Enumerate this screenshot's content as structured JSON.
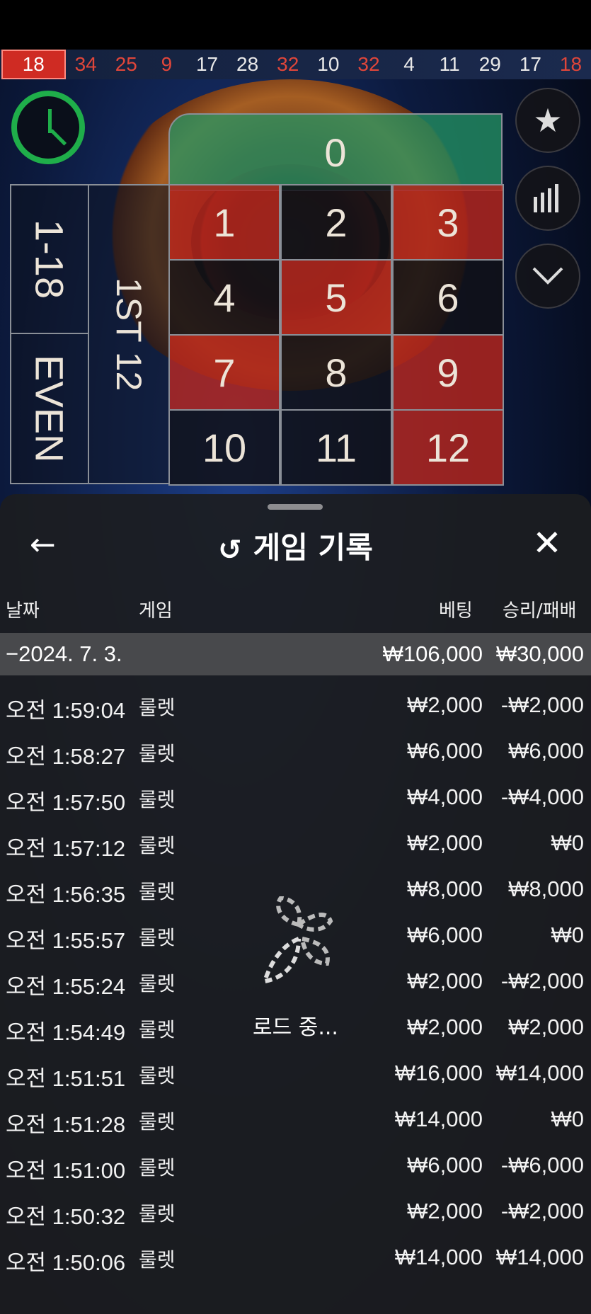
{
  "recent_results": [
    {
      "n": "18",
      "color": "red"
    },
    {
      "n": "34",
      "color": "red"
    },
    {
      "n": "25",
      "color": "red"
    },
    {
      "n": "9",
      "color": "red"
    },
    {
      "n": "17",
      "color": "black"
    },
    {
      "n": "28",
      "color": "black"
    },
    {
      "n": "32",
      "color": "red"
    },
    {
      "n": "10",
      "color": "black"
    },
    {
      "n": "32",
      "color": "red"
    },
    {
      "n": "4",
      "color": "black"
    },
    {
      "n": "11",
      "color": "black"
    },
    {
      "n": "29",
      "color": "black"
    },
    {
      "n": "17",
      "color": "black"
    },
    {
      "n": "18",
      "color": "red"
    }
  ],
  "board": {
    "zero": "0",
    "numbers": [
      {
        "n": "1",
        "c": "red"
      },
      {
        "n": "2",
        "c": "black"
      },
      {
        "n": "3",
        "c": "red"
      },
      {
        "n": "4",
        "c": "black"
      },
      {
        "n": "5",
        "c": "red"
      },
      {
        "n": "6",
        "c": "black"
      },
      {
        "n": "7",
        "c": "red"
      },
      {
        "n": "8",
        "c": "black"
      },
      {
        "n": "9",
        "c": "red"
      },
      {
        "n": "10",
        "c": "black"
      },
      {
        "n": "11",
        "c": "black"
      },
      {
        "n": "12",
        "c": "red"
      }
    ],
    "low_label": "1-18",
    "even_label": "EVEN",
    "dozen_label": "1ST 12"
  },
  "panel": {
    "title": "게임 기록",
    "columns": {
      "date": "날짜",
      "game": "게임",
      "bet": "베팅",
      "result": "승리/패배"
    },
    "date_summary": {
      "date": "−2024. 7. 3.",
      "bet": "₩106,000",
      "result": "₩30,000"
    },
    "rows": [
      {
        "time": "오전 1:59:04",
        "game": "룰렛",
        "bet": "₩2,000",
        "result": "-₩2,000"
      },
      {
        "time": "오전 1:58:27",
        "game": "룰렛",
        "bet": "₩6,000",
        "result": "₩6,000"
      },
      {
        "time": "오전 1:57:50",
        "game": "룰렛",
        "bet": "₩4,000",
        "result": "-₩4,000"
      },
      {
        "time": "오전 1:57:12",
        "game": "룰렛",
        "bet": "₩2,000",
        "result": "₩0"
      },
      {
        "time": "오전 1:56:35",
        "game": "룰렛",
        "bet": "₩8,000",
        "result": "₩8,000"
      },
      {
        "time": "오전 1:55:57",
        "game": "룰렛",
        "bet": "₩6,000",
        "result": "₩0"
      },
      {
        "time": "오전 1:55:24",
        "game": "룰렛",
        "bet": "₩2,000",
        "result": "-₩2,000"
      },
      {
        "time": "오전 1:54:49",
        "game": "룰렛",
        "bet": "₩2,000",
        "result": "₩2,000"
      },
      {
        "time": "오전 1:51:51",
        "game": "룰렛",
        "bet": "₩16,000",
        "result": "₩14,000"
      },
      {
        "time": "오전 1:51:28",
        "game": "룰렛",
        "bet": "₩14,000",
        "result": "₩0"
      },
      {
        "time": "오전 1:51:00",
        "game": "룰렛",
        "bet": "₩6,000",
        "result": "-₩6,000"
      },
      {
        "time": "오전 1:50:32",
        "game": "룰렛",
        "bet": "₩2,000",
        "result": "-₩2,000"
      },
      {
        "time": "오전 1:50:06",
        "game": "룰렛",
        "bet": "₩14,000",
        "result": "₩14,000"
      }
    ],
    "loading_text": "로드 중..."
  },
  "icons": {
    "back": "arrow-left-icon",
    "close": "close-icon",
    "history": "history-icon",
    "favorite": "star-icon",
    "stats": "bar-chart-icon",
    "collapse": "chevron-down-icon"
  },
  "colors": {
    "red": "#e0463a",
    "green_timer": "#1fae4a",
    "panel_bg": "#1c1d20"
  }
}
